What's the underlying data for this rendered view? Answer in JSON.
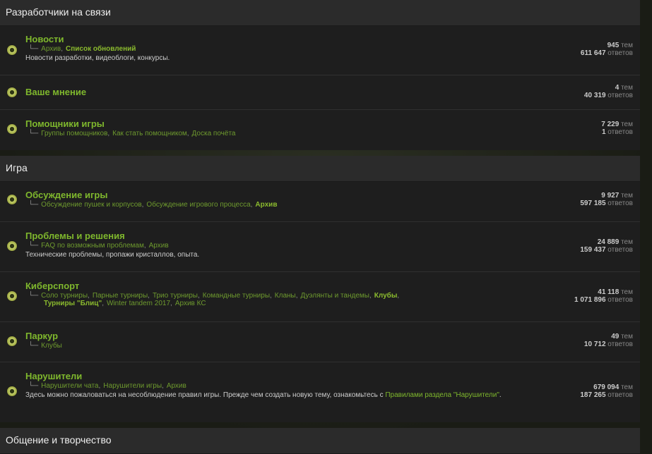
{
  "categories": [
    {
      "title": "Разработчики на связи",
      "forums": [
        {
          "title": "Новости",
          "subs": [
            {
              "t": "Архив",
              "b": false
            },
            {
              "t": "Список обновлений",
              "b": true
            }
          ],
          "desc": "Новости разработки, видеоблоги, конкурсы.",
          "topics": "945",
          "topics_label": "тем",
          "posts": "611 647",
          "posts_label": "ответов"
        },
        {
          "title": "Ваше мнение",
          "subs": [],
          "desc": "",
          "topics": "4",
          "topics_label": "тем",
          "posts": "40 319",
          "posts_label": "ответов"
        },
        {
          "title": "Помощники игры",
          "subs": [
            {
              "t": "Группы помощников",
              "b": false
            },
            {
              "t": "Как стать помощником",
              "b": false
            },
            {
              "t": "Доска почёта",
              "b": false
            }
          ],
          "desc": "",
          "topics": "7 229",
          "topics_label": "тем",
          "posts": "1",
          "posts_label": "ответов"
        }
      ]
    },
    {
      "title": "Игра",
      "forums": [
        {
          "title": "Обсуждение игры",
          "subs": [
            {
              "t": "Обсуждение пушек и корпусов",
              "b": false
            },
            {
              "t": "Обсуждение игрового процесса",
              "b": false
            },
            {
              "t": "Архив",
              "b": true
            }
          ],
          "desc": "",
          "topics": "9 927",
          "topics_label": "тем",
          "posts": "597 185",
          "posts_label": "ответов"
        },
        {
          "title": "Проблемы и решения",
          "subs": [
            {
              "t": "FAQ по возможным проблемам",
              "b": false
            },
            {
              "t": "Архив",
              "b": false
            }
          ],
          "desc": "Технические проблемы, пропажи кристаллов, опыта.",
          "topics": "24 889",
          "topics_label": "тем",
          "posts": "159 437",
          "posts_label": "ответов"
        },
        {
          "title": "Киберспорт",
          "subs": [
            {
              "t": "Соло турниры",
              "b": false
            },
            {
              "t": "Парные турниры",
              "b": false
            },
            {
              "t": "Трио турниры",
              "b": false
            },
            {
              "t": "Командные турниры",
              "b": false
            },
            {
              "t": "Кланы",
              "b": false
            },
            {
              "t": "Дуэлянты и тандемы",
              "b": false
            },
            {
              "t": "Клубы",
              "b": true
            },
            {
              "t": "Турниры \"Блиц\"",
              "b": true
            },
            {
              "t": "Winter tandem 2017",
              "b": false
            },
            {
              "t": "Архив КС",
              "b": false
            }
          ],
          "desc": "",
          "topics": "41 118",
          "topics_label": "тем",
          "posts": "1 071 896",
          "posts_label": "ответов"
        },
        {
          "title": "Паркур",
          "subs": [
            {
              "t": "Клубы",
              "b": false
            }
          ],
          "desc": "",
          "topics": "49",
          "topics_label": "тем",
          "posts": "10 712",
          "posts_label": "ответов"
        },
        {
          "title": "Нарушители",
          "subs": [
            {
              "t": "Нарушители чата",
              "b": false
            },
            {
              "t": "Нарушители игры",
              "b": false
            },
            {
              "t": "Архив",
              "b": false
            }
          ],
          "desc": "Здесь можно пожаловаться на несоблюдение правил игры. Прежде чем создать новую тему, ознакомьтесь с ",
          "desc_link": "Правилами раздела \"Нарушители\"",
          "desc_end": ".",
          "topics": "679 094",
          "topics_label": "тем",
          "posts": "187 265",
          "posts_label": "ответов"
        }
      ]
    },
    {
      "title": "Общение и творчество",
      "forums": []
    }
  ]
}
